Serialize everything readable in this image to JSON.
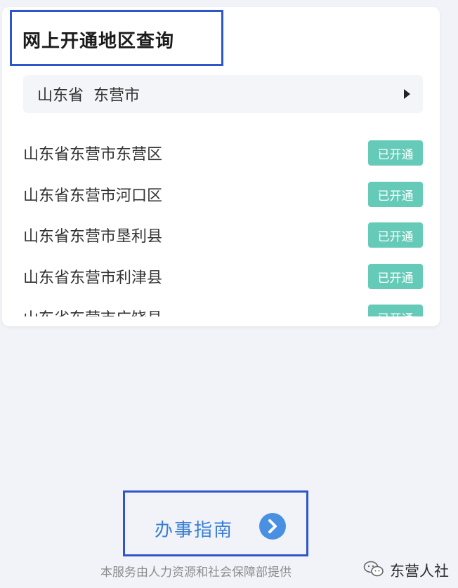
{
  "panel": {
    "title": "网上开通地区查询",
    "region_selector": {
      "province": "山东省",
      "city": "东营市"
    },
    "areas": [
      {
        "name": "山东省东营市东营区",
        "status": "已开通"
      },
      {
        "name": "山东省东营市河口区",
        "status": "已开通"
      },
      {
        "name": "山东省东营市垦利县",
        "status": "已开通"
      },
      {
        "name": "山东省东营市利津县",
        "status": "已开通"
      },
      {
        "name": "山东省东营市广饶县",
        "status": "已开通"
      }
    ]
  },
  "guide": {
    "label": "办事指南"
  },
  "footer": {
    "provider_text": "本服务由人力资源和社会保障部提供"
  },
  "watermark": {
    "text": "东营人社"
  },
  "colors": {
    "accent_blue": "#3a7fd6",
    "badge_teal": "#65cbb8",
    "highlight_box": "#2f56c9"
  }
}
